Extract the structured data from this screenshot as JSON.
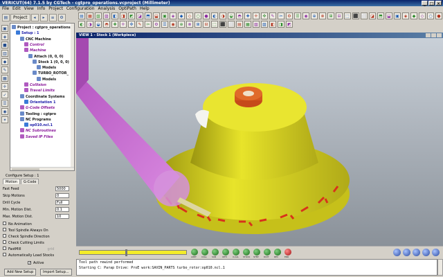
{
  "window": {
    "title": "VERICUT(64)  7.1.5 by CGTech - cgtpro_operations.vcproject (Millimeter)",
    "minimize": "_",
    "maximize": "□",
    "close": "×"
  },
  "menu": [
    "File",
    "Edit",
    "View",
    "Info",
    "Project",
    "Configuration",
    "Analysis",
    "OptiPath",
    "Help"
  ],
  "left_toolbar": {
    "project_button": "Project"
  },
  "tree": {
    "items": [
      {
        "label": "Project : cgtpro_operations",
        "style": "black",
        "indent": 0
      },
      {
        "label": "Setup : 1",
        "style": "blue",
        "indent": 1
      },
      {
        "label": "CNC Machine",
        "style": "black",
        "indent": 2
      },
      {
        "label": "Control",
        "style": "purple",
        "indent": 3
      },
      {
        "label": "Machine",
        "style": "purple",
        "indent": 3
      },
      {
        "label": "Attach (0, 0, 0)",
        "style": "black",
        "indent": 4
      },
      {
        "label": "Stock 1 (0, 0, 0)",
        "style": "black",
        "indent": 5
      },
      {
        "label": "Models",
        "style": "black",
        "indent": 6
      },
      {
        "label": "TURBO_ROTOR_",
        "style": "black",
        "indent": 5
      },
      {
        "label": "Models",
        "style": "black",
        "indent": 6
      },
      {
        "label": "Collision",
        "style": "purple",
        "indent": 3
      },
      {
        "label": "Travel Limits",
        "style": "purple",
        "indent": 3
      },
      {
        "label": "Coordinate Systems",
        "style": "black",
        "indent": 2
      },
      {
        "label": "Orientation 1",
        "style": "blue",
        "indent": 3
      },
      {
        "label": "G-Code Offsets",
        "style": "purple",
        "indent": 2
      },
      {
        "label": "Tooling : cgtpro",
        "style": "black",
        "indent": 2
      },
      {
        "label": "NC Programs",
        "style": "black",
        "indent": 2
      },
      {
        "label": "op010.ncl.1",
        "style": "blue",
        "indent": 3
      },
      {
        "label": "NC Subroutines",
        "style": "purple",
        "indent": 2
      },
      {
        "label": "Saved IP Files",
        "style": "purple",
        "indent": 2
      }
    ]
  },
  "config": {
    "header": "Configure Setup : 1",
    "tabs": [
      "Motion",
      "G-Code"
    ],
    "fields": [
      {
        "label": "Fast Feed",
        "value": "5000"
      },
      {
        "label": "Skip Motions",
        "value": "0"
      },
      {
        "label": "Drill Cycle",
        "value": "Full"
      },
      {
        "label": "Min. Motion Dist.",
        "value": "0.1"
      },
      {
        "label": "Max. Motion Dist.",
        "value": "10"
      }
    ],
    "checks": [
      "No Animation",
      "Tool Spindle Always On",
      "Check Spindle Direction",
      "Check Cutting Limits",
      "FastMill",
      "Automatically Load Stocks"
    ],
    "fastmill_extra": "grid",
    "active_label": "Active",
    "add_button": "Add New Setup",
    "import_button": "Import Setup..."
  },
  "view": {
    "title": "VIEW 1 - Stock 1 (Workpiece)"
  },
  "animation": {
    "progress": 0.43,
    "buttons": [
      "LIMIT",
      "COLL",
      "SUB",
      "OPTI",
      "X-CAL",
      "STOCK",
      "STEP",
      "DOIT",
      "REV",
      "ERR"
    ]
  },
  "log": {
    "lines": [
      "Tool path rewind performed",
      "Starting C: Parap Drive: ProE work:SAVIN_PARTS turbo_rotor:op010.ncl.1"
    ]
  },
  "colors": {
    "accent": "#0a246a",
    "part": "#e4e22a",
    "tool": "#c86ad0"
  }
}
